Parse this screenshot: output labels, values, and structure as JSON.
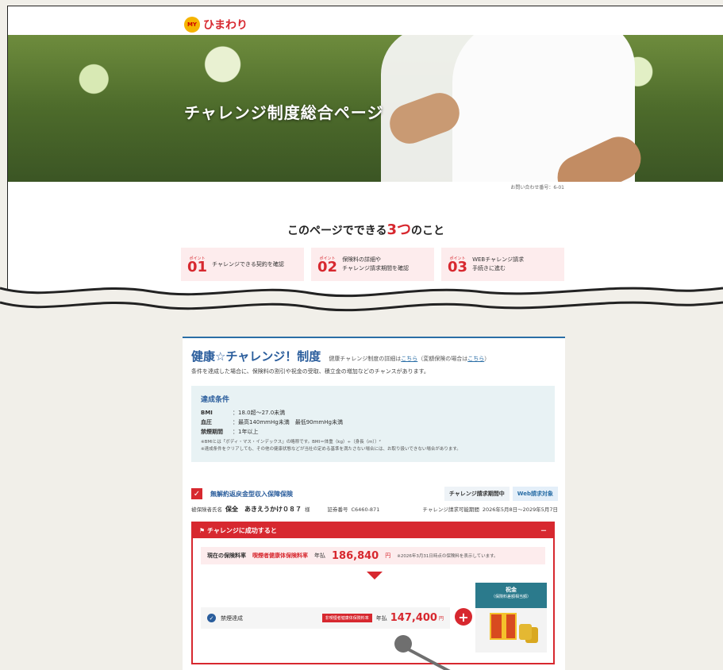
{
  "brand": {
    "mark": "MY",
    "name": "ひまわり"
  },
  "hero": {
    "title": "チャレンジ制度総合ページ"
  },
  "inquiry": "お問い合わせ番号：6-01",
  "points": {
    "heading_pre": "このページでできる",
    "heading_num": "3つ",
    "heading_post": "のこと",
    "point_label": "ポイント",
    "items": [
      {
        "num": "01",
        "text": "チャレンジできる契約を確認"
      },
      {
        "num": "02",
        "text": "保険料の詳細や\nチャレンジ請求期間を確認"
      },
      {
        "num": "03",
        "text": "WEBチャレンジ請求\n手続きに進む"
      }
    ]
  },
  "card": {
    "title": "健康☆チャレンジ！制度",
    "link_pre": "健康チャレンジ制度の詳細は",
    "link1": "こちら",
    "link_mid": "（変額保険の場合は",
    "link2": "こちら",
    "link_post": "）",
    "desc": "条件を達成した場合に、保険料の割引や祝金の受取、積立金の増加などのチャンスがあります。",
    "conditions": {
      "title": "達成条件",
      "rows": [
        {
          "k": "BMI",
          "v": "：18.0超～27.0未満"
        },
        {
          "k": "血圧",
          "v": "：最高140mmHg未満　最低90mmHg未満"
        },
        {
          "k": "禁煙期間",
          "v": "：1年以上"
        }
      ],
      "note1": "※BMIとは「ボディ・マス・インデックス」の略称です。BMI＝体重（kg）÷（身長（m））²",
      "note2": "※達成条件をクリアしても、その他の健康状態などが当社の定める基準を満たさない場合には、お取り扱いできない場合があります。"
    },
    "plan": {
      "check": "✓",
      "name": "無解約返戻金型収入保障保険",
      "badge1": "チャレンジ請求期間中",
      "badge2": "Web請求対象"
    },
    "insured": {
      "label": "被保険者氏名",
      "name": "保全　あきえうかけ０８７",
      "honor": "様",
      "cert_label": "証券番号",
      "cert": "C6460-871",
      "period_label": "チャレンジ請求可能期間",
      "period": "2026年5月8日～2029年5月7日"
    },
    "success": {
      "title": "チャレンジに成功すると",
      "collapse": "－",
      "current_label": "現在の保険料率",
      "current_tag": "喫煙者健康体保険料率",
      "current_prefix": "年払",
      "current_amount": "186,840",
      "current_yen": "円",
      "current_note": "※2026年3月31日時点の保険料を表示しています。",
      "result_label": "禁煙達成",
      "result_tag": "非喫煙者健康体保険料率",
      "result_prefix": "年払",
      "result_amount": "147,400",
      "result_yen": "円",
      "plus": "+",
      "gift_title": "祝金",
      "gift_sub": "（保険料差額相当額）"
    }
  }
}
